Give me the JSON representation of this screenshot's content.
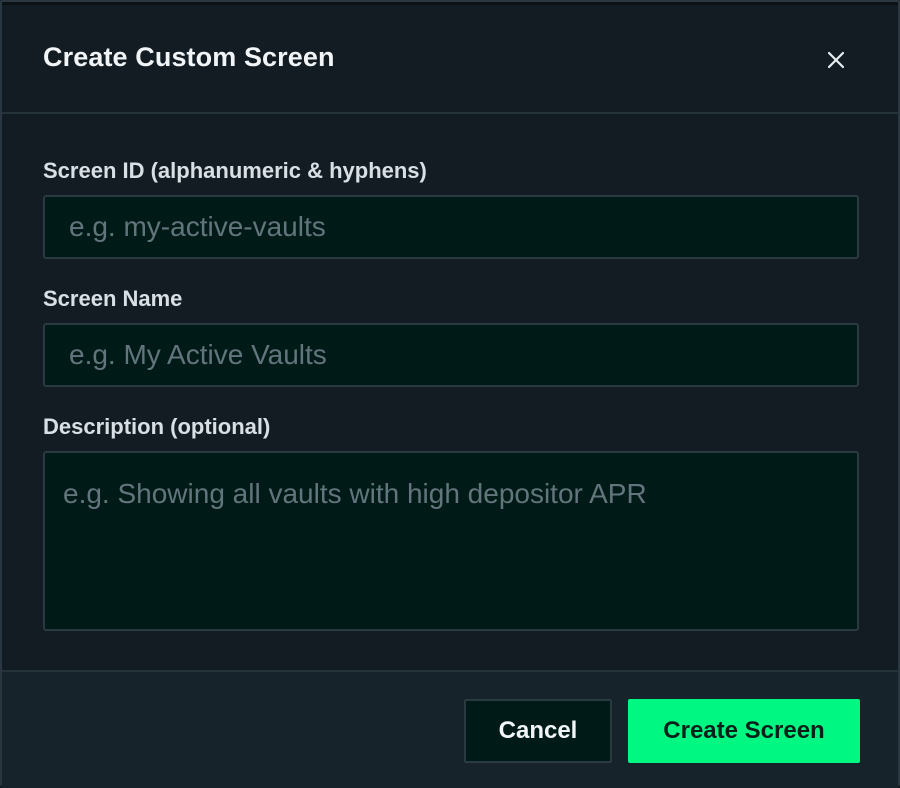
{
  "dialog": {
    "title": "Create Custom Screen",
    "close_icon": "close-icon"
  },
  "form": {
    "screen_id": {
      "label": "Screen ID (alphanumeric & hyphens)",
      "value": "",
      "placeholder": "e.g. my-active-vaults"
    },
    "screen_name": {
      "label": "Screen Name",
      "value": "",
      "placeholder": "e.g. My Active Vaults"
    },
    "description": {
      "label": "Description (optional)",
      "value": "",
      "placeholder": "e.g. Showing all vaults with high depositor APR"
    }
  },
  "actions": {
    "cancel_label": "Cancel",
    "create_label": "Create Screen"
  },
  "colors": {
    "background": "#121c22",
    "input_background": "#001a17",
    "accent": "#00f882",
    "border": "#2a3a40"
  }
}
